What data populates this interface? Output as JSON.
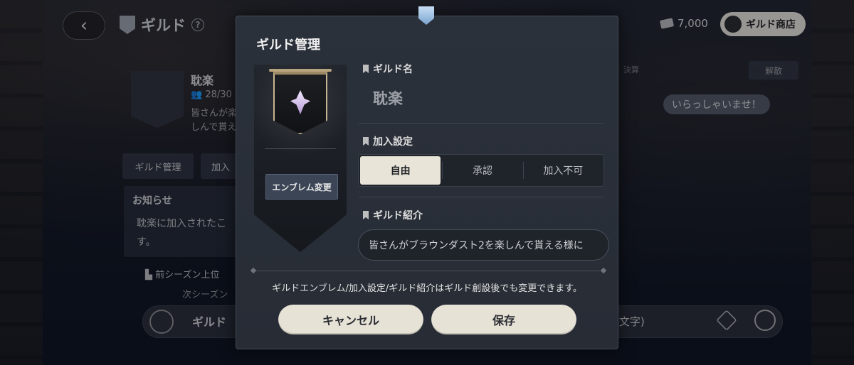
{
  "header": {
    "title": "ギルド",
    "currency_amount": "7,000",
    "shop_label": "ギルド商店"
  },
  "background": {
    "guild_name": "耽楽",
    "member_count": "28/30",
    "description": "皆さんが楽しんで貰え",
    "tabs": [
      "ギルド管理",
      "加入"
    ],
    "notice_title": "お知らせ",
    "notice_body": "耽楽に加入されたこす。",
    "season_text": "前シーズン上位",
    "season_next": "次シーズン",
    "chat_label": "ギルド",
    "chat_count": ")文字)",
    "right_label": "決算",
    "right_button": "解散",
    "welcome_message": "いらっしゃいませ！"
  },
  "modal": {
    "title": "ギルド管理",
    "emblem_change_label": "エンブレム変更",
    "name_label": "ギルド名",
    "name_value": "耽楽",
    "join_label": "加入設定",
    "join_options": [
      "自由",
      "承認",
      "加入不可"
    ],
    "join_selected": "自由",
    "intro_label": "ギルド紹介",
    "intro_value": "皆さんがブラウンダスト2を楽しんで貰える様に",
    "footer_note": "ギルドエンブレム/加入設定/ギルド紹介はギルド創設後でも変更できます。",
    "cancel_label": "キャンセル",
    "save_label": "保存"
  },
  "colors": {
    "modal_bg": "#2b313b",
    "button_bg": "#e7e2d6",
    "accent": "#9cc7ef"
  }
}
